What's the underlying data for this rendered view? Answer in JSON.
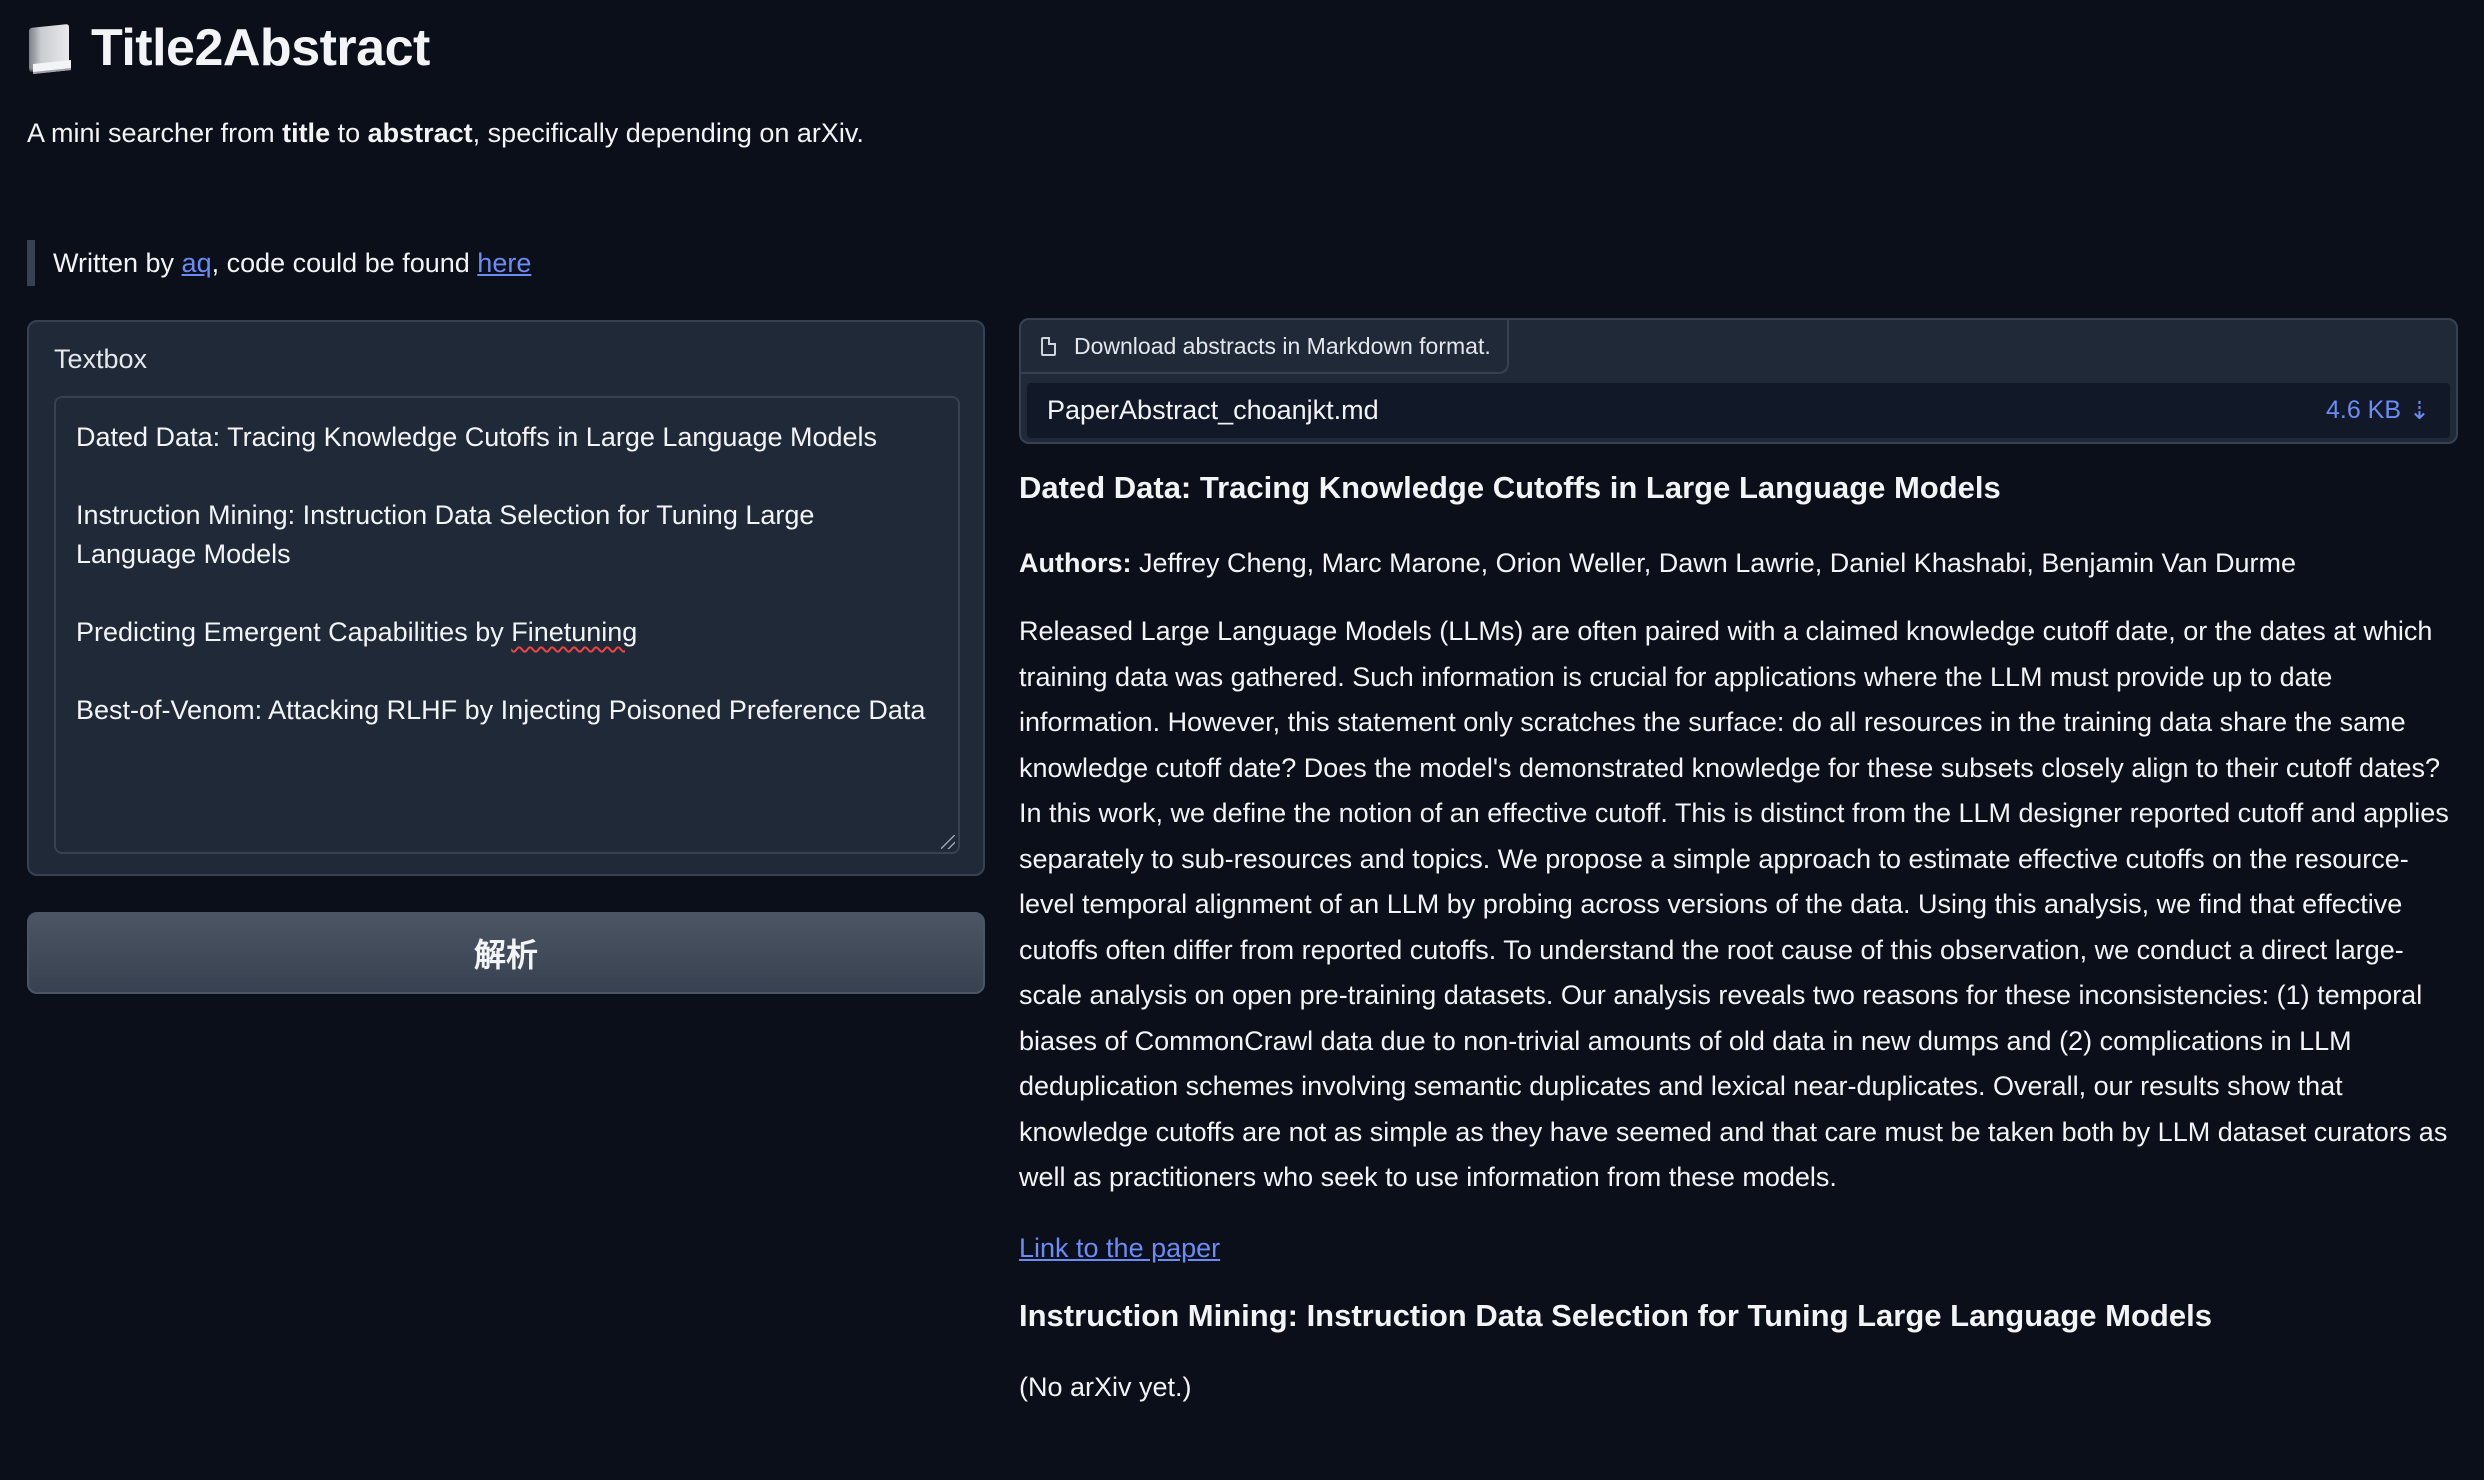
{
  "header": {
    "title": "Title2Abstract",
    "icon": "book-icon",
    "subtitle_prefix": "A mini searcher from ",
    "subtitle_bold1": "title",
    "subtitle_mid": " to ",
    "subtitle_bold2": "abstract",
    "subtitle_suffix": ", specifically depending on arXiv."
  },
  "note": {
    "prefix": "Written by ",
    "author_link": "aq",
    "middle": ", code could be found ",
    "code_link": "here"
  },
  "input": {
    "label": "Textbox",
    "lines": [
      "Dated Data: Tracing Knowledge Cutoffs in Large Language Models",
      "Instruction Mining: Instruction Data Selection for Tuning Large Language Models",
      "Predicting Emergent Capabilities by ",
      "Best-of-Venom: Attacking RLHF by Injecting Poisoned Preference Data"
    ],
    "misspelled_word": "Finetuning"
  },
  "parse_button": {
    "label": "解析"
  },
  "file": {
    "label": "Download abstracts in Markdown format.",
    "name": "PaperAbstract_choanjkt.md",
    "size": "4.6 KB",
    "download_icon": "⇣"
  },
  "results": [
    {
      "title": "Dated Data: Tracing Knowledge Cutoffs in Large Language Models",
      "authors_label": "Authors:",
      "authors": " Jeffrey Cheng, Marc Marone, Orion Weller, Dawn Lawrie, Daniel Khashabi, Benjamin Van Durme",
      "abstract": "Released Large Language Models (LLMs) are often paired with a claimed knowledge cutoff date, or the dates at which training data was gathered. Such information is crucial for applications where the LLM must provide up to date information. However, this statement only scratches the surface: do all resources in the training data share the same knowledge cutoff date? Does the model's demonstrated knowledge for these subsets closely align to their cutoff dates? In this work, we define the notion of an effective cutoff. This is distinct from the LLM designer reported cutoff and applies separately to sub-resources and topics. We propose a simple approach to estimate effective cutoffs on the resource-level temporal alignment of an LLM by probing across versions of the data. Using this analysis, we find that effective cutoffs often differ from reported cutoffs. To understand the root cause of this observation, we conduct a direct large-scale analysis on open pre-training datasets. Our analysis reveals two reasons for these inconsistencies: (1) temporal biases of CommonCrawl data due to non-trivial amounts of old data in new dumps and (2) complications in LLM deduplication schemes involving semantic duplicates and lexical near-duplicates. Overall, our results show that knowledge cutoffs are not as simple as they have seemed and that care must be taken both by LLM dataset curators as well as practitioners who seek to use information from these models.",
      "link_label": "Link to the paper"
    },
    {
      "title": "Instruction Mining: Instruction Data Selection for Tuning Large Language Models",
      "status": "(No arXiv yet.)"
    }
  ]
}
